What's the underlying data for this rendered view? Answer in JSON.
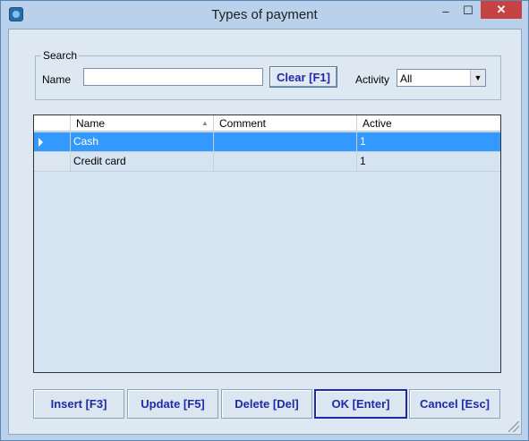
{
  "window": {
    "title": "Types of payment",
    "close_glyph": "✕",
    "minimize_glyph": "–",
    "maximize_glyph": "☐"
  },
  "search": {
    "legend": "Search",
    "name_label": "Name",
    "name_value": "",
    "name_placeholder": "",
    "clear_label": "Clear [F1]",
    "activity_label": "Activity",
    "activity_value": "All"
  },
  "grid": {
    "columns": [
      "Name",
      "Comment",
      "Active"
    ],
    "rows": [
      {
        "name": "Cash",
        "comment": "",
        "active": "1",
        "selected": true
      },
      {
        "name": "Credit card",
        "comment": "",
        "active": "1",
        "selected": false
      }
    ]
  },
  "footer": {
    "insert_label": "Insert [F3]",
    "update_label": "Update [F5]",
    "delete_label": "Delete [Del]",
    "ok_label": "OK [Enter]",
    "cancel_label": "Cancel [Esc]"
  },
  "colors": {
    "selection": "#3399ff",
    "button_text": "#1f2aa8",
    "close": "#c74343"
  },
  "icons": [
    "app-icon",
    "sort-asc-icon",
    "row-pointer-icon",
    "dropdown-arrow-icon",
    "resize-grip-icon"
  ]
}
